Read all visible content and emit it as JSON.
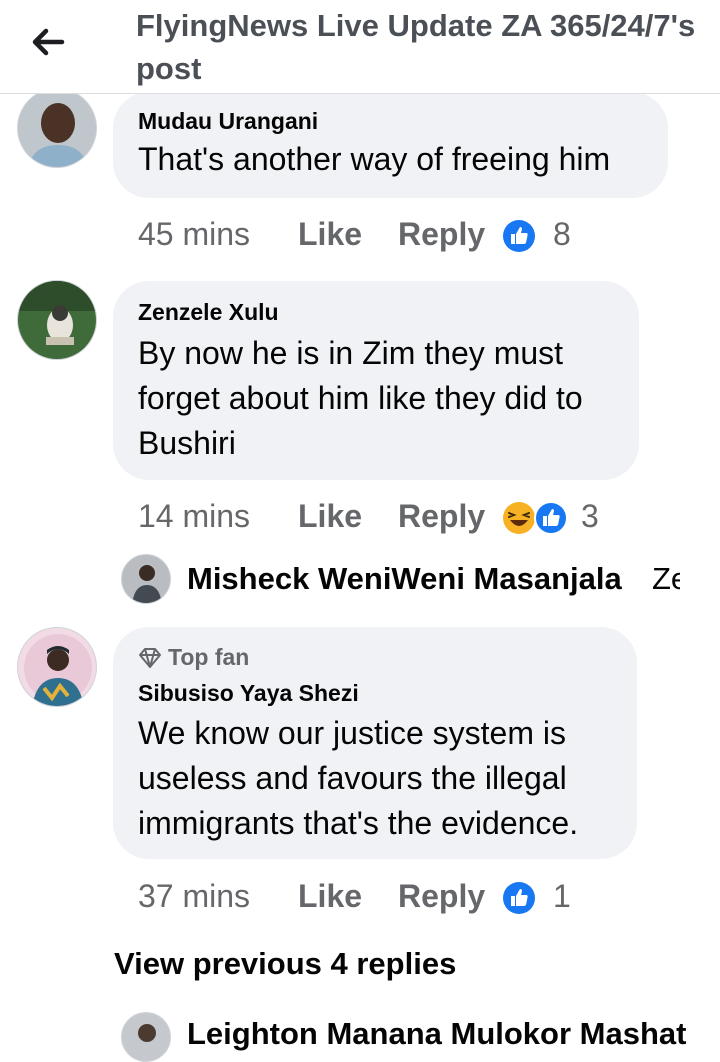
{
  "header": {
    "title": "FlyingNews Live Update ZA 365/24/7's post"
  },
  "comments": [
    {
      "author": "Mudau Urangani",
      "text": "That's another way of freeing him",
      "time": "45 mins",
      "like_label": "Like",
      "reply_label": "Reply",
      "reactions": [
        "like"
      ],
      "reaction_count": "8"
    },
    {
      "author": "Zenzele Xulu",
      "text": "By now he is in Zim they must forget about him like they did to Bushiri",
      "text_lines": [
        "By now he is in Zim they must",
        "forget about him like they did to",
        "Bushiri"
      ],
      "time": "14 mins",
      "like_label": "Like",
      "reply_label": "Reply",
      "reactions": [
        "haha",
        "like"
      ],
      "reaction_count": "3"
    },
    {
      "badge": "Top fan",
      "author": "Sibusiso Yaya Shezi",
      "text_lines": [
        "We know our justice system is",
        "useless and favours the illegal",
        "immigrants that's the evidence."
      ],
      "time": "37 mins",
      "like_label": "Like",
      "reply_label": "Reply",
      "reactions": [
        "like"
      ],
      "reaction_count": "1"
    }
  ],
  "reply_preview": {
    "author": "Misheck WeniWeni Masanjala",
    "snippet": "Ze"
  },
  "view_previous": "View previous 4 replies",
  "next_reply_preview": {
    "author": "Leighton Manana Mulokor Mashat"
  },
  "colors": {
    "bubble": "#f0f2f5",
    "meta_text": "#65676b",
    "like_blue": "#1877f2",
    "haha_yellow": "#f7b125"
  },
  "icons": {
    "back": "back-arrow-icon",
    "like": "like-reaction-icon",
    "haha": "haha-reaction-icon",
    "top_fan": "diamond-icon"
  }
}
